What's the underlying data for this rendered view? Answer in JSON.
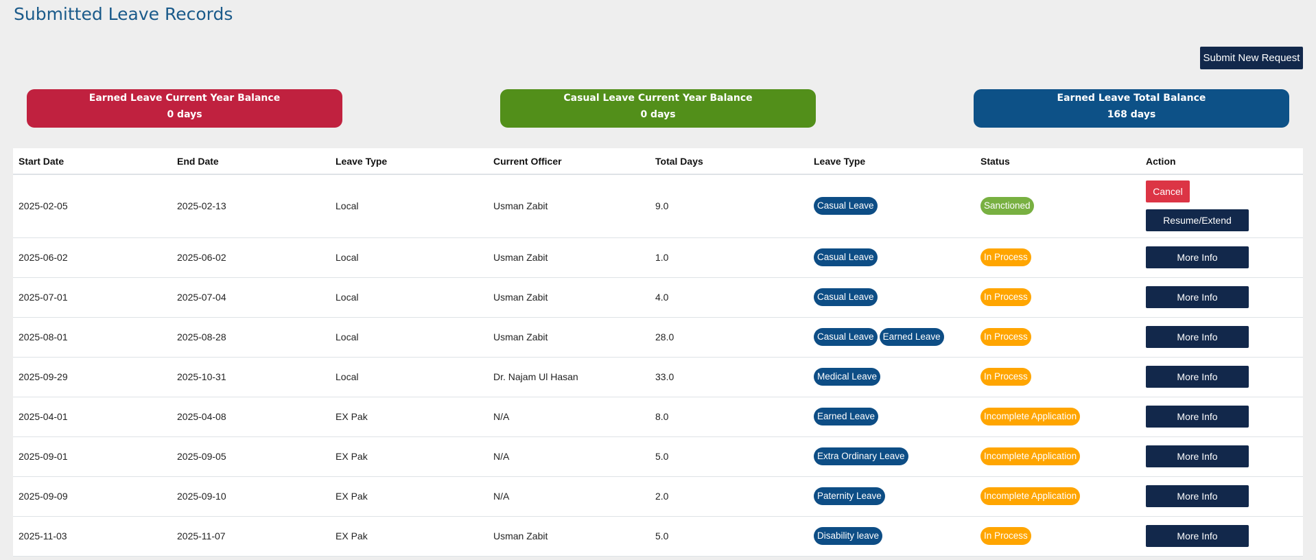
{
  "page": {
    "title": "Submitted Leave Records",
    "submit_label": "Submit New Request"
  },
  "cards": [
    {
      "title": "Earned Leave Current Year Balance",
      "value": "0 days",
      "color": "#c0213f"
    },
    {
      "title": "Casual Leave Current Year Balance",
      "value": "0 days",
      "color": "#528f1a"
    },
    {
      "title": "Earned Leave Total Balance",
      "value": "168 days",
      "color": "#0d5187"
    }
  ],
  "table": {
    "headers": [
      "Start Date",
      "End Date",
      "Leave Type",
      "Current Officer",
      "Total Days",
      "Leave Type",
      "Status",
      "Action"
    ],
    "rows": [
      {
        "start": "2025-02-05",
        "end": "2025-02-13",
        "type": "Local",
        "officer": "Usman Zabit",
        "days": "9.0",
        "leave": [
          "Casual Leave"
        ],
        "status": "Sanctioned",
        "actions": [
          "Cancel",
          "Resume/Extend"
        ]
      },
      {
        "start": "2025-06-02",
        "end": "2025-06-02",
        "type": "Local",
        "officer": "Usman Zabit",
        "days": "1.0",
        "leave": [
          "Casual Leave"
        ],
        "status": "In Process",
        "actions": [
          "More Info"
        ]
      },
      {
        "start": "2025-07-01",
        "end": "2025-07-04",
        "type": "Local",
        "officer": "Usman Zabit",
        "days": "4.0",
        "leave": [
          "Casual Leave"
        ],
        "status": "In Process",
        "actions": [
          "More Info"
        ]
      },
      {
        "start": "2025-08-01",
        "end": "2025-08-28",
        "type": "Local",
        "officer": "Usman Zabit",
        "days": "28.0",
        "leave": [
          "Casual Leave",
          "Earned Leave"
        ],
        "status": "In Process",
        "actions": [
          "More Info"
        ]
      },
      {
        "start": "2025-09-29",
        "end": "2025-10-31",
        "type": "Local",
        "officer": "Dr. Najam Ul Hasan",
        "days": "33.0",
        "leave": [
          "Medical Leave"
        ],
        "status": "In Process",
        "actions": [
          "More Info"
        ]
      },
      {
        "start": "2025-04-01",
        "end": "2025-04-08",
        "type": "EX Pak",
        "officer": "N/A",
        "days": "8.0",
        "leave": [
          "Earned Leave"
        ],
        "status": "Incomplete Application",
        "actions": [
          "More Info"
        ]
      },
      {
        "start": "2025-09-01",
        "end": "2025-09-05",
        "type": "EX Pak",
        "officer": "N/A",
        "days": "5.0",
        "leave": [
          "Extra Ordinary Leave"
        ],
        "status": "Incomplete Application",
        "actions": [
          "More Info"
        ]
      },
      {
        "start": "2025-09-09",
        "end": "2025-09-10",
        "type": "EX Pak",
        "officer": "N/A",
        "days": "2.0",
        "leave": [
          "Paternity Leave"
        ],
        "status": "Incomplete Application",
        "actions": [
          "More Info"
        ]
      },
      {
        "start": "2025-11-03",
        "end": "2025-11-07",
        "type": "EX Pak",
        "officer": "Usman Zabit",
        "days": "5.0",
        "leave": [
          "Disability leave"
        ],
        "status": "In Process",
        "actions": [
          "More Info"
        ]
      }
    ]
  },
  "colors": {
    "title": "#1a5a8a",
    "dark_button": "#12284b",
    "cancel_button": "#dc3545",
    "type_pill": "#0d4d85",
    "sanctioned": "#78b041",
    "in_process": "#ffa500"
  }
}
